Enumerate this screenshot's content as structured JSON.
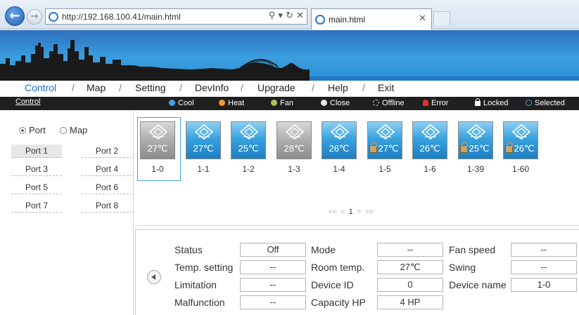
{
  "browser": {
    "url": "http://192.168.100.41/main.html",
    "tab_title": "main.html"
  },
  "menu": {
    "items": [
      "Control",
      "Map",
      "Setting",
      "DevInfo",
      "Upgrade",
      "Help",
      "Exit"
    ],
    "separator": "/"
  },
  "toolbar": {
    "section": "Control",
    "legend": [
      {
        "label": "Cool",
        "color": "#3ea2e6"
      },
      {
        "label": "Heat",
        "color": "#f39a2a"
      },
      {
        "label": "Fan",
        "color": "#a9c25c"
      },
      {
        "label": "Close",
        "color": "#e5e5e5"
      },
      {
        "label": "Offline",
        "color": "#dddddd"
      },
      {
        "label": "Error",
        "color": "#e0332b"
      },
      {
        "label": "Locked",
        "color": "#ffffff"
      },
      {
        "label": "Selected",
        "color": "#3ea2e6"
      }
    ]
  },
  "sidebar": {
    "radio_port": "Port",
    "radio_map": "Map",
    "ports": [
      "Port 1",
      "Port 2",
      "Port 3",
      "Port 4",
      "Port 5",
      "Port 6",
      "Port 7",
      "Port 8"
    ]
  },
  "devices": [
    {
      "id": "1-0",
      "temp": "27℃",
      "state": "close",
      "locked": false,
      "selected": true
    },
    {
      "id": "1-1",
      "temp": "27℃",
      "state": "cool",
      "locked": false,
      "selected": false
    },
    {
      "id": "1-2",
      "temp": "25℃",
      "state": "cool",
      "locked": false,
      "selected": false
    },
    {
      "id": "1-3",
      "temp": "28℃",
      "state": "close",
      "locked": false,
      "selected": false
    },
    {
      "id": "1-4",
      "temp": "26℃",
      "state": "cool",
      "locked": false,
      "selected": false
    },
    {
      "id": "1-5",
      "temp": "27℃",
      "state": "cool",
      "locked": true,
      "selected": false
    },
    {
      "id": "1-6",
      "temp": "26℃",
      "state": "cool",
      "locked": false,
      "selected": false
    },
    {
      "id": "1-39",
      "temp": "25℃",
      "state": "cool",
      "locked": true,
      "selected": false
    },
    {
      "id": "1-60",
      "temp": "26℃",
      "state": "cool",
      "locked": true,
      "selected": false
    }
  ],
  "pager": {
    "first": "<<",
    "prev": "<",
    "page": "1",
    "next": ">",
    "last": ">>"
  },
  "details": {
    "status_label": "Status",
    "status": "Off",
    "mode_label": "Mode",
    "mode": "--",
    "fan_label": "Fan speed",
    "fan": "--",
    "temp_setting_label": "Temp. setting",
    "temp_setting": "--",
    "room_temp_label": "Room temp.",
    "room_temp": "27℃",
    "swing_label": "Swing",
    "swing": "--",
    "limitation_label": "Limitation",
    "limitation": "--",
    "device_id_label": "Device ID",
    "device_id": "0",
    "device_name_label": "Device name",
    "device_name": "1-0",
    "malfunction_label": "Malfunction",
    "malfunction": "--",
    "capacity_label": "Capacity HP",
    "capacity": "4  HP"
  }
}
